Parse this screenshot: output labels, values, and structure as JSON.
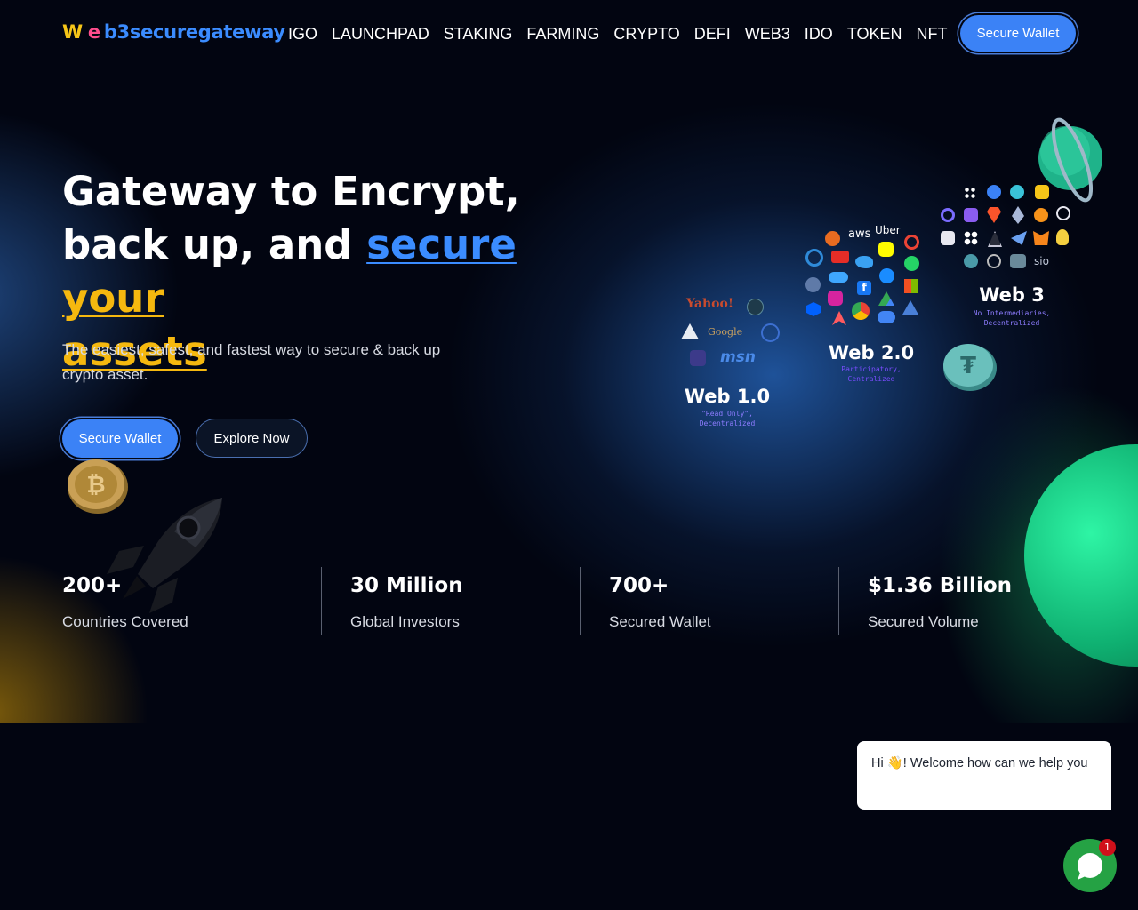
{
  "nav": {
    "logo_w": "W",
    "logo_e": "e",
    "logo_rest": "b3securegateway",
    "items": [
      "IGO",
      "LAUNCHPAD",
      "STAKING",
      "FARMING",
      "CRYPTO",
      "DEFI",
      "WEB3",
      "IDO",
      "TOKEN",
      "NFT"
    ],
    "cta": "Secure Wallet"
  },
  "hero": {
    "title_line1": "Gateway to Encrypt,",
    "title_line2_plain": "back up, and ",
    "title_blue": "secure",
    "title_gold_1": "your",
    "title_gold_2": "assets",
    "subtitle": "The easiest, safest, and fastest way to secure & back up crypto asset.",
    "primary_button": "Secure Wallet",
    "secondary_button": "Explore Now"
  },
  "illustration": {
    "web1_title": "Web 1.0",
    "web1_sub": "\"Read Only\", Decentralized",
    "web2_title": "Web 2.0",
    "web2_sub": "Participatory, Centralized",
    "web3_title": "Web 3",
    "web3_sub": "No Intermediaries, Decentralized",
    "web1_logos": [
      "Yahoo!",
      "Google",
      "msn"
    ],
    "web2_logos": [
      "aws",
      "Uber"
    ],
    "web3_logos": [
      "sio"
    ]
  },
  "stats": [
    {
      "value": "200+",
      "label": "Countries Covered"
    },
    {
      "value": "30 Million",
      "label": "Global Investors"
    },
    {
      "value": "700+",
      "label": "Secured Wallet"
    },
    {
      "value": "$1.36 Billion",
      "label": "Secured Volume"
    }
  ],
  "chat": {
    "message_hi": "Hi",
    "message_rest": "! Welcome how can we help you",
    "badge_count": "1"
  },
  "colors": {
    "background": "#020511",
    "accent_blue": "#3b82f6",
    "accent_gold": "#f5b80f",
    "chat_green": "#25a244",
    "badge_red": "#d0101a"
  }
}
